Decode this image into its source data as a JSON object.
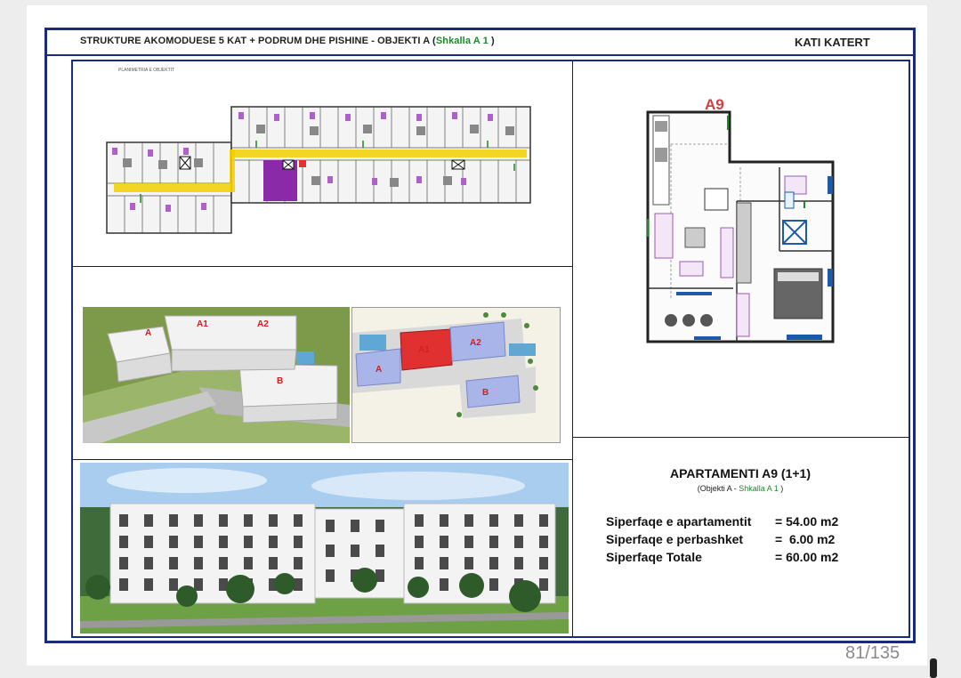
{
  "header": {
    "title_main": "STRUKTURE AKOMODUESE 5 KAT + PODRUM DHE PISHINE",
    "title_sep": " - ",
    "title_obj": "OBJEKTI A (",
    "title_stair": "Shkalla A 1",
    "title_close": " )",
    "floor": "KATI KATERT"
  },
  "plan": {
    "caption": "PLANIMETRIA E OBJEKTIT"
  },
  "unit_plan": {
    "label": "A9"
  },
  "renders": {
    "aerial_labels": [
      "A",
      "A1",
      "A2",
      "B"
    ],
    "site_labels": [
      "A",
      "A1",
      "A2",
      "B"
    ]
  },
  "apartment": {
    "title": "APARTAMENTI A9 (1+1)",
    "sub_obj": "(Objekti A - ",
    "sub_stair": "Shkalla A 1",
    "sub_close": " )",
    "rows": [
      {
        "label": "Siperfaqe e apartamentit",
        "value": "= 54.00 m2"
      },
      {
        "label": "Siperfaqe e perbashket",
        "value": "=  6.00 m2"
      },
      {
        "label": "Siperfaqe Totale",
        "value": "= 60.00 m2"
      }
    ]
  },
  "viewer": {
    "page_indicator": "81/135"
  },
  "colors": {
    "frame": "#1c2a7a",
    "accent_green": "#1a8a2a",
    "highlight_red": "#e03030",
    "plan_purple": "#8a2aa8",
    "corridor_yellow": "#f2d000"
  }
}
